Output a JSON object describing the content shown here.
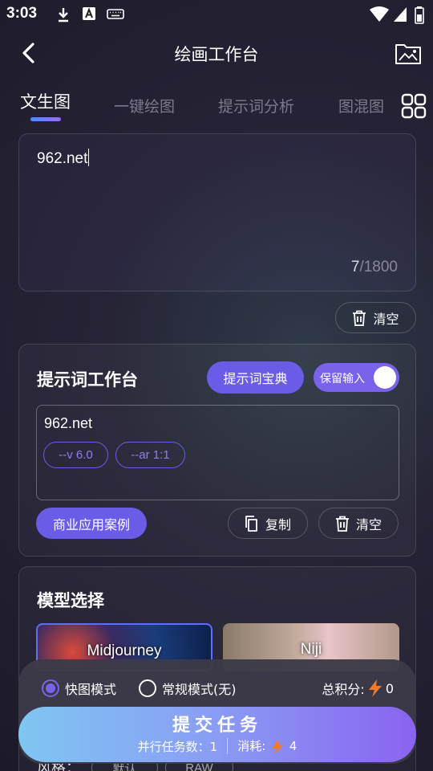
{
  "status": {
    "time": "3:03"
  },
  "header": {
    "title": "绘画工作台"
  },
  "tabs": [
    {
      "label": "文生图",
      "active": true
    },
    {
      "label": "一键绘图",
      "active": false
    },
    {
      "label": "提示词分析",
      "active": false
    },
    {
      "label": "图混图",
      "active": false
    }
  ],
  "prompt": {
    "text": "962.net",
    "count": "7",
    "max": "/1800"
  },
  "clear_label": "清空",
  "workbench": {
    "title": "提示词工作台",
    "dictionary_label": "提示词宝典",
    "keep_input_label": "保留输入",
    "keep_input_on": true,
    "text": "962.net",
    "tags": [
      "--v 6.0",
      "--ar 1:1"
    ],
    "case_label": "商业应用案例",
    "copy_label": "复制",
    "clear_label": "清空"
  },
  "model": {
    "title": "模型选择",
    "options": [
      "Midjourney",
      "Niji"
    ],
    "selected": "Midjourney",
    "style_label": "风格：",
    "style_options": [
      "默认",
      "RAW"
    ]
  },
  "bottom": {
    "mode_fast": "快图模式",
    "mode_normal": "常规模式(无)",
    "selected_mode": "快图模式",
    "points_label": "总积分:",
    "points_value": "0",
    "submit_label": "提交任务",
    "parallel_label": "并行任务数：1",
    "cost_label": "消耗:",
    "cost_value": "4"
  },
  "colors": {
    "accent": "#6b5ce8",
    "bolt": "#f07a2a"
  }
}
